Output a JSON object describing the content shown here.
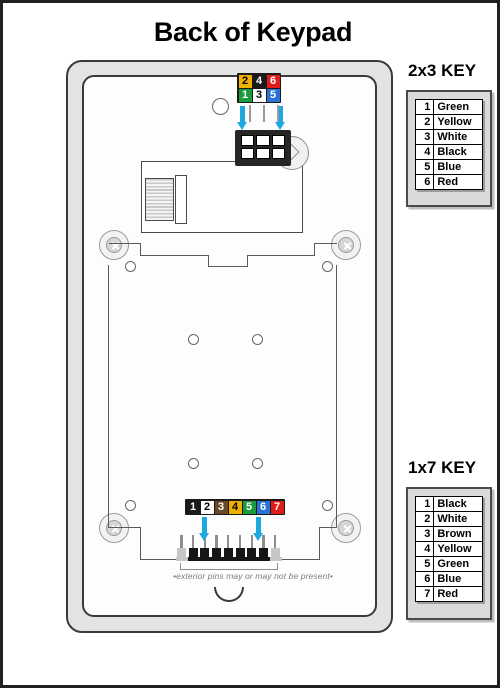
{
  "page": {
    "title": "Back of Keypad",
    "background_color": "#ffffff",
    "border_color": "#231f20"
  },
  "keypad": {
    "housing_color": "#e3e3e3",
    "inner_color": "#fdfdfd",
    "outline_color": "#3a3a3a",
    "notch_label": "bottom-notch"
  },
  "connector_2x3": {
    "name": "2x3 header",
    "arrow_color": "#1fa8e0",
    "rows": [
      [
        {
          "num": "2",
          "bg": "#f0b000",
          "fg": "#000000"
        },
        {
          "num": "4",
          "bg": "#1a1a1a",
          "fg": "#ffffff"
        },
        {
          "num": "6",
          "bg": "#e01b1b",
          "fg": "#ffffff"
        }
      ],
      [
        {
          "num": "1",
          "bg": "#1a9b3c",
          "fg": "#ffffff"
        },
        {
          "num": "3",
          "bg": "#ffffff",
          "fg": "#000000"
        },
        {
          "num": "5",
          "bg": "#2a72d4",
          "fg": "#ffffff"
        }
      ]
    ]
  },
  "connector_1x7": {
    "name": "1x7 header",
    "arrow_color": "#1fa8e0",
    "pins": [
      {
        "num": "1",
        "bg": "#1a1a1a",
        "fg": "#ffffff"
      },
      {
        "num": "2",
        "bg": "#ffffff",
        "fg": "#000000"
      },
      {
        "num": "3",
        "bg": "#6b4a2a",
        "fg": "#ffffff"
      },
      {
        "num": "4",
        "bg": "#f0b000",
        "fg": "#000000"
      },
      {
        "num": "5",
        "bg": "#1a9b3c",
        "fg": "#ffffff"
      },
      {
        "num": "6",
        "bg": "#2a72d4",
        "fg": "#ffffff"
      },
      {
        "num": "7",
        "bg": "#e01b1b",
        "fg": "#ffffff"
      }
    ],
    "note": "•exterior pins may or may not be present•"
  },
  "key_2x3": {
    "title": "2x3 KEY",
    "rows": [
      {
        "num": "1",
        "color": "Green"
      },
      {
        "num": "2",
        "color": "Yellow"
      },
      {
        "num": "3",
        "color": "White"
      },
      {
        "num": "4",
        "color": "Black"
      },
      {
        "num": "5",
        "color": "Blue"
      },
      {
        "num": "6",
        "color": "Red"
      }
    ]
  },
  "key_1x7": {
    "title": "1x7 KEY",
    "rows": [
      {
        "num": "1",
        "color": "Black"
      },
      {
        "num": "2",
        "color": "White"
      },
      {
        "num": "3",
        "color": "Brown"
      },
      {
        "num": "4",
        "color": "Yellow"
      },
      {
        "num": "5",
        "color": "Green"
      },
      {
        "num": "6",
        "color": "Blue"
      },
      {
        "num": "7",
        "color": "Red"
      }
    ]
  }
}
